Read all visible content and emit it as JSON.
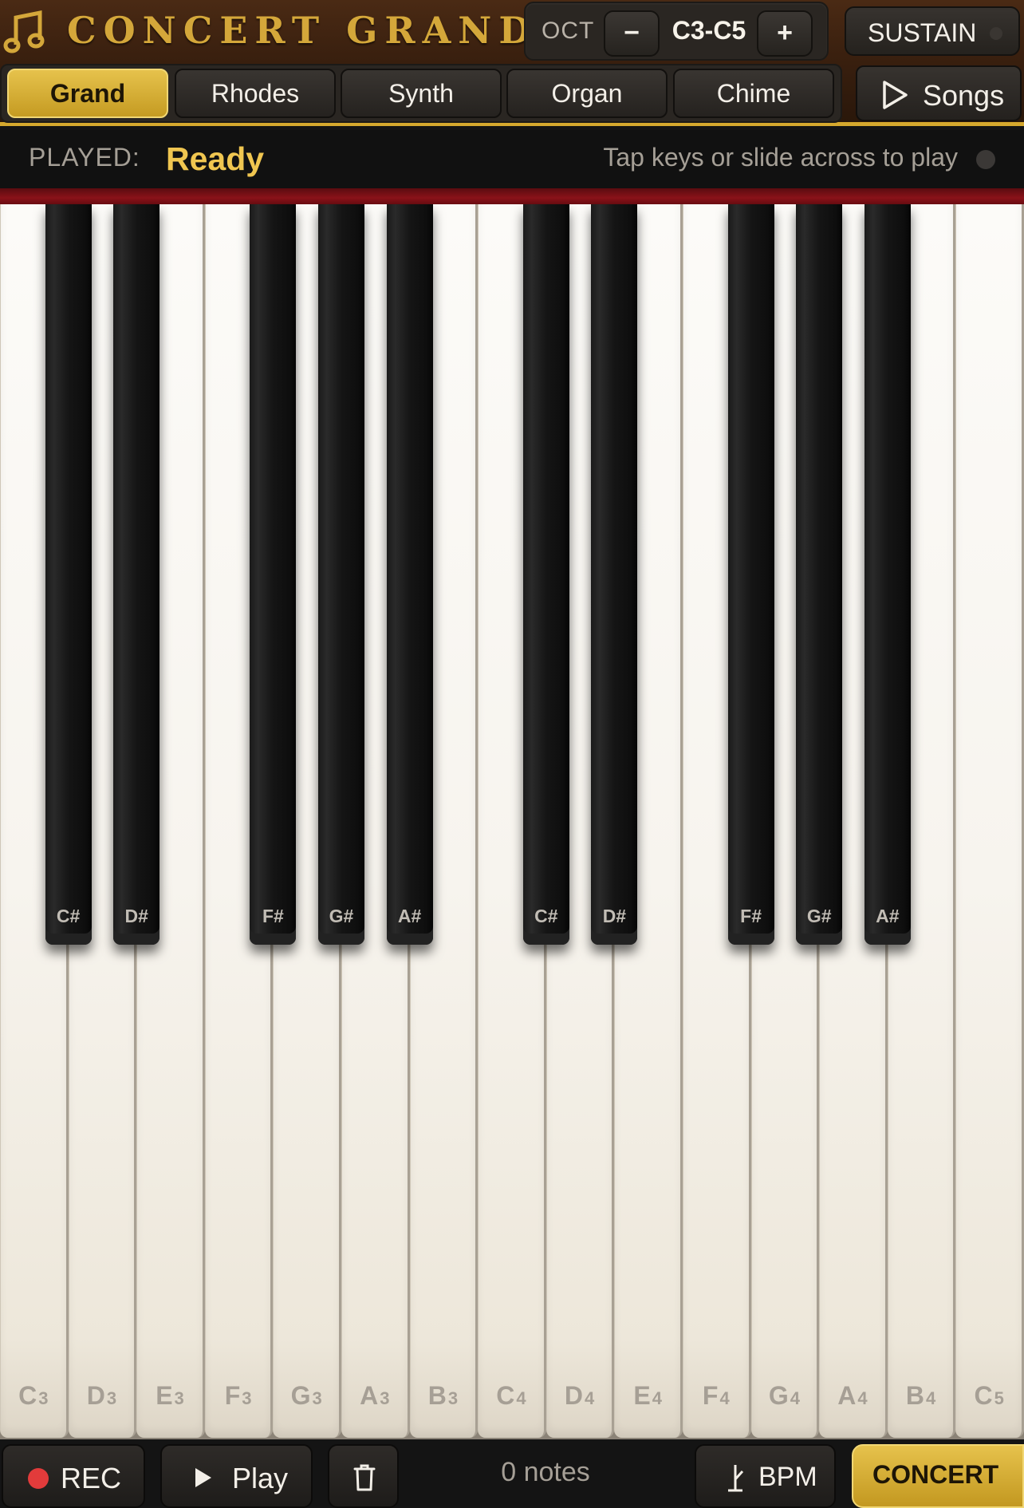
{
  "header": {
    "title": "CONCERT GRAND",
    "logo_icon": "music-note-icon",
    "accent_color": "#d4a73a",
    "octave": {
      "label": "OCT",
      "minus": "−",
      "plus": "+",
      "range": "C3-C5"
    },
    "sustain": {
      "label": "SUSTAIN",
      "enabled": false
    }
  },
  "tabs": {
    "items": [
      "Grand",
      "Rhodes",
      "Synth",
      "Organ",
      "Chime"
    ],
    "active": "Grand",
    "songs_label": "Songs"
  },
  "status": {
    "played_label": "PLAYED:",
    "played_value": "Ready",
    "hint": "Tap keys or slide across to play"
  },
  "keyboard": {
    "white_keys": [
      {
        "note": "C",
        "octave": "3"
      },
      {
        "note": "D",
        "octave": "3"
      },
      {
        "note": "E",
        "octave": "3"
      },
      {
        "note": "F",
        "octave": "3"
      },
      {
        "note": "G",
        "octave": "3"
      },
      {
        "note": "A",
        "octave": "3"
      },
      {
        "note": "B",
        "octave": "3"
      },
      {
        "note": "C",
        "octave": "4"
      },
      {
        "note": "D",
        "octave": "4"
      },
      {
        "note": "E",
        "octave": "4"
      },
      {
        "note": "F",
        "octave": "4"
      },
      {
        "note": "G",
        "octave": "4"
      },
      {
        "note": "A",
        "octave": "4"
      },
      {
        "note": "B",
        "octave": "4"
      },
      {
        "note": "C",
        "octave": "5"
      }
    ],
    "black_keys": [
      "C#",
      "D#",
      "F#",
      "G#",
      "A#",
      "C#",
      "D#",
      "F#",
      "G#",
      "A#"
    ]
  },
  "toolbar": {
    "rec_label": "REC",
    "play_label": "Play",
    "notes_count": "0 notes",
    "bpm_label": "BPM",
    "concert_label": "CONCERT"
  }
}
